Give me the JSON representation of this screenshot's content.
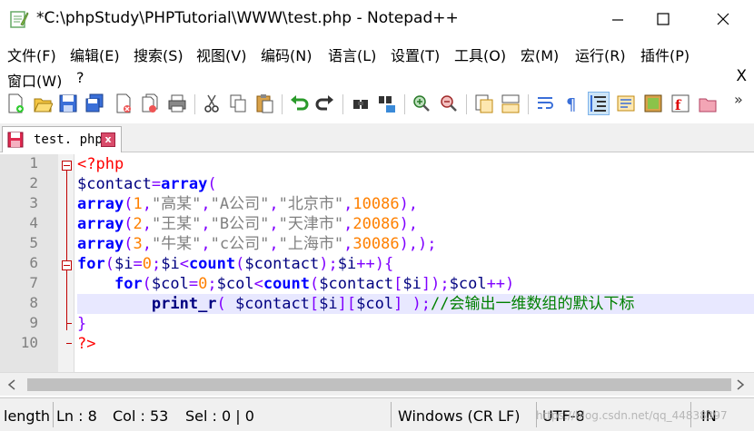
{
  "window": {
    "title": "*C:\\phpStudy\\PHPTutorial\\WWW\\test.php - Notepad++",
    "minimize_symbol": "—",
    "close_symbol": "✕"
  },
  "menu": {
    "items": [
      "文件(F)",
      "编辑(E)",
      "搜索(S)",
      "视图(V)",
      "编码(N)",
      "语言(L)",
      "设置(T)",
      "工具(O)",
      "宏(M)",
      "运行(R)",
      "插件(P)",
      "窗口(W)",
      "?"
    ],
    "close_doc": "X"
  },
  "toolbar": {
    "icons": [
      "new-file-icon",
      "open-file-icon",
      "save-icon",
      "save-all-icon",
      "close-icon",
      "close-all-icon",
      "print-icon",
      "cut-icon",
      "copy-icon",
      "paste-icon",
      "undo-icon",
      "redo-icon",
      "find-icon",
      "replace-icon",
      "zoom-in-icon",
      "zoom-out-icon",
      "sync-vertical-icon",
      "sync-horizontal-icon",
      "word-wrap-icon",
      "show-all-chars-icon",
      "indent-guide-icon",
      "doc-map-icon",
      "function-list-icon",
      "record-macro-icon",
      "folder-workspace-icon"
    ],
    "overflow": "»"
  },
  "tab": {
    "label": "test. php",
    "close": "x"
  },
  "editor": {
    "line_numbers": [
      "1",
      "2",
      "3",
      "4",
      "5",
      "6",
      "7",
      "8",
      "9",
      "10"
    ],
    "lines": [
      [
        {
          "t": "<?php",
          "c": "php-tag"
        }
      ],
      [
        {
          "t": "$contact",
          "c": "var"
        },
        {
          "t": "=",
          "c": "op"
        },
        {
          "t": "array",
          "c": "kw"
        },
        {
          "t": "(",
          "c": "op"
        }
      ],
      [
        {
          "t": "array",
          "c": "kw"
        },
        {
          "t": "(",
          "c": "op"
        },
        {
          "t": "1",
          "c": "num"
        },
        {
          "t": ",",
          "c": "op"
        },
        {
          "t": "\"高某\"",
          "c": "str"
        },
        {
          "t": ",",
          "c": "op"
        },
        {
          "t": "\"A公司\"",
          "c": "str"
        },
        {
          "t": ",",
          "c": "op"
        },
        {
          "t": "\"北京市\"",
          "c": "str"
        },
        {
          "t": ",",
          "c": "op"
        },
        {
          "t": "10086",
          "c": "num"
        },
        {
          "t": "),",
          "c": "op"
        }
      ],
      [
        {
          "t": "array",
          "c": "kw"
        },
        {
          "t": "(",
          "c": "op"
        },
        {
          "t": "2",
          "c": "num"
        },
        {
          "t": ",",
          "c": "op"
        },
        {
          "t": "\"王某\"",
          "c": "str"
        },
        {
          "t": ",",
          "c": "op"
        },
        {
          "t": "\"B公司\"",
          "c": "str"
        },
        {
          "t": ",",
          "c": "op"
        },
        {
          "t": "\"天津市\"",
          "c": "str"
        },
        {
          "t": ",",
          "c": "op"
        },
        {
          "t": "20086",
          "c": "num"
        },
        {
          "t": "),",
          "c": "op"
        }
      ],
      [
        {
          "t": "array",
          "c": "kw"
        },
        {
          "t": "(",
          "c": "op"
        },
        {
          "t": "3",
          "c": "num"
        },
        {
          "t": ",",
          "c": "op"
        },
        {
          "t": "\"牛某\"",
          "c": "str"
        },
        {
          "t": ",",
          "c": "op"
        },
        {
          "t": "\"c公司\"",
          "c": "str"
        },
        {
          "t": ",",
          "c": "op"
        },
        {
          "t": "\"上海市\"",
          "c": "str"
        },
        {
          "t": ",",
          "c": "op"
        },
        {
          "t": "30086",
          "c": "num"
        },
        {
          "t": "),);",
          "c": "op"
        }
      ],
      [
        {
          "t": "for",
          "c": "kw"
        },
        {
          "t": "(",
          "c": "op"
        },
        {
          "t": "$i",
          "c": "var"
        },
        {
          "t": "=",
          "c": "op"
        },
        {
          "t": "0",
          "c": "num"
        },
        {
          "t": ";",
          "c": "op"
        },
        {
          "t": "$i",
          "c": "var"
        },
        {
          "t": "<",
          "c": "op"
        },
        {
          "t": "count",
          "c": "kw"
        },
        {
          "t": "(",
          "c": "op"
        },
        {
          "t": "$contact",
          "c": "var"
        },
        {
          "t": ");",
          "c": "op"
        },
        {
          "t": "$i",
          "c": "var"
        },
        {
          "t": "++){",
          "c": "op"
        }
      ],
      [
        {
          "t": "    ",
          "c": ""
        },
        {
          "t": "for",
          "c": "kw"
        },
        {
          "t": "(",
          "c": "op"
        },
        {
          "t": "$col",
          "c": "var"
        },
        {
          "t": "=",
          "c": "op"
        },
        {
          "t": "0",
          "c": "num"
        },
        {
          "t": ";",
          "c": "op"
        },
        {
          "t": "$col",
          "c": "var"
        },
        {
          "t": "<",
          "c": "op"
        },
        {
          "t": "count",
          "c": "kw"
        },
        {
          "t": "(",
          "c": "op"
        },
        {
          "t": "$contact",
          "c": "var"
        },
        {
          "t": "[",
          "c": "op"
        },
        {
          "t": "$i",
          "c": "var"
        },
        {
          "t": "]);",
          "c": "op"
        },
        {
          "t": "$col",
          "c": "var"
        },
        {
          "t": "++)",
          "c": "op"
        }
      ],
      [
        {
          "t": "        ",
          "c": ""
        },
        {
          "t": "print_r",
          "c": "fn"
        },
        {
          "t": "( ",
          "c": "op"
        },
        {
          "t": "$contact",
          "c": "var"
        },
        {
          "t": "[",
          "c": "op"
        },
        {
          "t": "$i",
          "c": "var"
        },
        {
          "t": "][",
          "c": "op"
        },
        {
          "t": "$col",
          "c": "var"
        },
        {
          "t": "] );",
          "c": "op"
        },
        {
          "t": "//会输出一维数组的默认下标",
          "c": "cmt"
        }
      ],
      [
        {
          "t": "}",
          "c": "op"
        }
      ],
      [
        {
          "t": "?>",
          "c": "php-tag"
        }
      ]
    ]
  },
  "status": {
    "length": "length",
    "ln": "Ln : 8",
    "col": "Col : 53",
    "sel": "Sel : 0 | 0",
    "eol": "Windows (CR LF)",
    "encoding": "UTF-8",
    "mode": "IN",
    "watermark": "https://blog.csdn.net/qq_44838397"
  },
  "colors": {
    "php_tag": "#ff0000",
    "variable": "#000080",
    "keyword": "#0000ff",
    "operator": "#8000ff",
    "number": "#ff8000",
    "string": "#808080",
    "comment": "#008000",
    "current_line": "#e8e8ff"
  }
}
